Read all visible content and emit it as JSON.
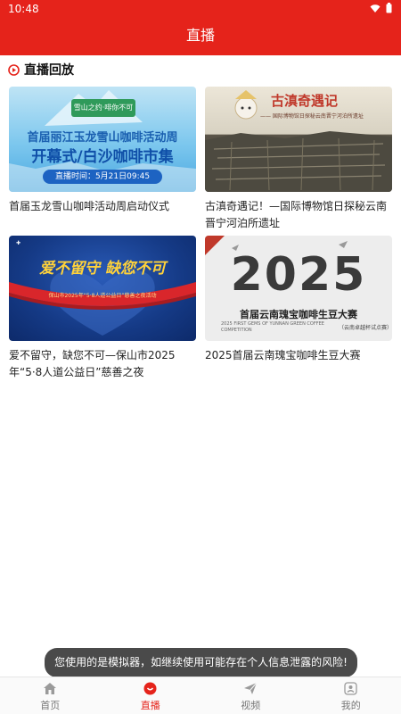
{
  "status_bar": {
    "time": "10:48",
    "icons": [
      "wifi-icon",
      "battery-icon"
    ]
  },
  "header": {
    "title": "直播"
  },
  "section": {
    "title": "直播回放",
    "icon": "live-play-icon"
  },
  "videos": [
    {
      "caption": "首届玉龙雪山咖啡活动周启动仪式",
      "poster": {
        "badge": "雪山之约·啡你不可",
        "line1": "首届丽江玉龙雪山咖啡活动周",
        "line2": "开幕式/白沙咖啡市集",
        "time": "直播时间：5月21日09:45"
      }
    },
    {
      "caption": "古滇奇遇记！—国际博物馆日探秘云南晋宁河泊所遗址",
      "poster": {
        "title": "古滇奇遇记",
        "sub": "—— 国际博物馆日探秘云南晋宁河泊所遗址"
      }
    },
    {
      "caption": "爱不留守，缺您不可—保山市2025年“5·8人道公益日”慈善之夜",
      "poster": {
        "title": "爱不留守 缺您不可",
        "sub": "保山市2025年“5·8人道公益日”慈善之夜活动"
      }
    },
    {
      "caption": "2025首届云南瑰宝咖啡生豆大赛",
      "poster": {
        "year": "2025",
        "title": "首届云南瑰宝咖啡生豆大赛",
        "sub": "2025 FIRST GEMS OF YUNNAN GREEN COFFEE COMPETITION",
        "tag": "（云南卓越杯试点赛）"
      }
    }
  ],
  "toast": {
    "text": "您使用的是模拟器，如继续使用可能存在个人信息泄露的风险!"
  },
  "tab_bar": {
    "active_color": "#e5231b",
    "items": [
      {
        "label": "首页",
        "icon": "home-icon"
      },
      {
        "label": "直播",
        "icon": "live-icon"
      },
      {
        "label": "视频",
        "icon": "send-icon"
      },
      {
        "label": "我的",
        "icon": "profile-icon"
      }
    ]
  }
}
